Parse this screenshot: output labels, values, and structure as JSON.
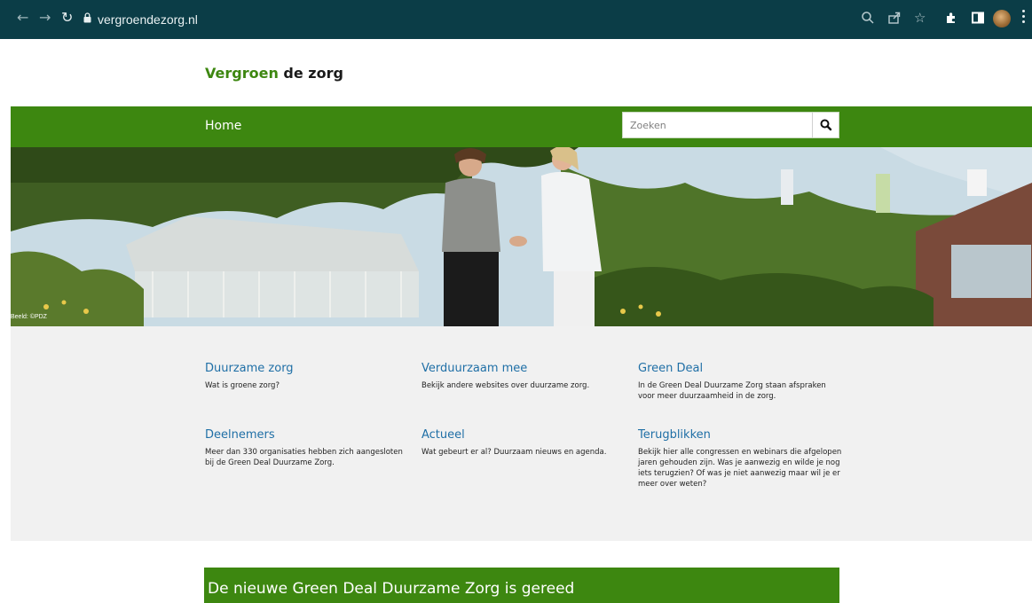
{
  "browser": {
    "url": "vergroendezorg.nl"
  },
  "header": {
    "brand_green": "Vergroen",
    "brand_rest": " de zorg"
  },
  "nav": {
    "home": "Home",
    "search_placeholder": "Zoeken"
  },
  "hero": {
    "credit": "Beeld: ©PDZ"
  },
  "tiles": [
    {
      "title": "Duurzame zorg",
      "desc": "Wat is groene zorg?"
    },
    {
      "title": "Verduurzaam mee",
      "desc": "Bekijk andere websites over duurzame zorg."
    },
    {
      "title": "Green Deal",
      "desc": "In de Green Deal Duurzame Zorg staan afspraken voor meer duurzaamheid in de zorg."
    },
    {
      "title": "Deelnemers",
      "desc": "Meer dan 330 organisaties hebben zich aangesloten bij de Green Deal Duurzame Zorg."
    },
    {
      "title": "Actueel",
      "desc": "Wat gebeurt er al? Duurzaam nieuws en agenda."
    },
    {
      "title": "Terugblikken",
      "desc": "Bekijk hier alle congressen en webinars die afgelopen jaren gehouden zijn. Was je aanwezig en wilde je nog iets terugzien? Of was je niet aanwezig maar wil je er meer over weten?"
    }
  ],
  "banner": {
    "title": "De nieuwe Green Deal Duurzame Zorg is gereed"
  },
  "colors": {
    "brand_green": "#3d8710",
    "link_blue": "#1f6fa6",
    "browser_bar": "#0b3d47"
  }
}
